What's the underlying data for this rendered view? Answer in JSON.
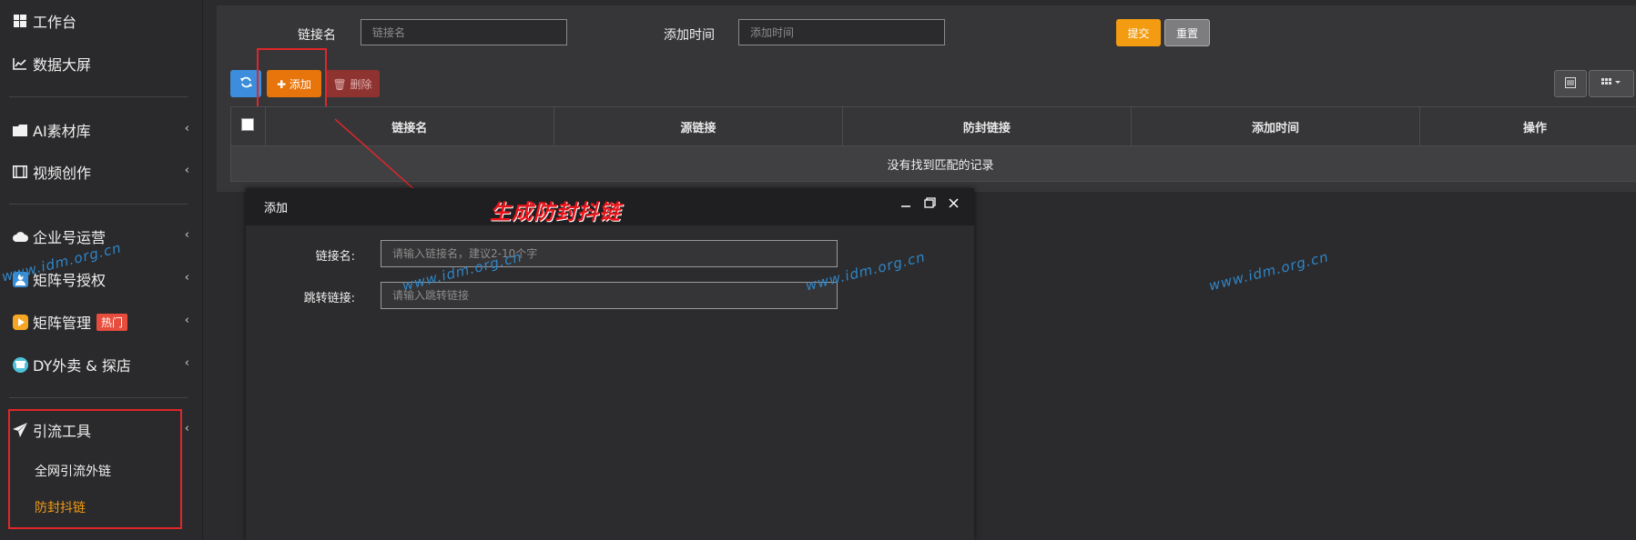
{
  "sidebar": {
    "items": [
      {
        "label": "工作台",
        "icon": "windows-icon"
      },
      {
        "label": "数据大屏",
        "icon": "line-chart-icon"
      },
      {
        "label": "AI素材库",
        "icon": "folder-icon"
      },
      {
        "label": "视频创作",
        "icon": "film-icon"
      },
      {
        "label": "企业号运营",
        "icon": "cloud-icon"
      },
      {
        "label": "矩阵号授权",
        "icon": "user-icon"
      },
      {
        "label": "矩阵管理",
        "icon": "play-icon",
        "badge": "热门"
      },
      {
        "label": "DY外卖 & 探店",
        "icon": "store-icon"
      },
      {
        "label": "引流工具",
        "icon": "send-icon"
      }
    ],
    "sub_items": [
      {
        "label": "全网引流外链"
      },
      {
        "label": "防封抖链",
        "active": true
      }
    ],
    "chevron": "‹"
  },
  "filter": {
    "link_name_label": "链接名",
    "link_name_placeholder": "链接名",
    "add_time_label": "添加时间",
    "add_time_placeholder": "添加时间",
    "submit": "提交",
    "reset": "重置"
  },
  "toolbar": {
    "refresh_icon": "refresh-icon",
    "add": "✚ 添加",
    "delete": "🗑 删除"
  },
  "table": {
    "columns": [
      "链接名",
      "源链接",
      "防封链接",
      "添加时间",
      "操作"
    ],
    "empty": "没有找到匹配的记录"
  },
  "modal": {
    "title": "添加",
    "fields": [
      {
        "label": "链接名:",
        "placeholder": "请输入链接名，建议2-10个字"
      },
      {
        "label": "跳转链接:",
        "placeholder": "请输入跳转链接"
      }
    ]
  },
  "annotation": "生成防封抖链",
  "watermark": "www.idm.org.cn",
  "colors": {
    "accent_orange": "#f39c12",
    "annotation_red": "#e8141a",
    "hot_badge": "#e74c3c"
  }
}
